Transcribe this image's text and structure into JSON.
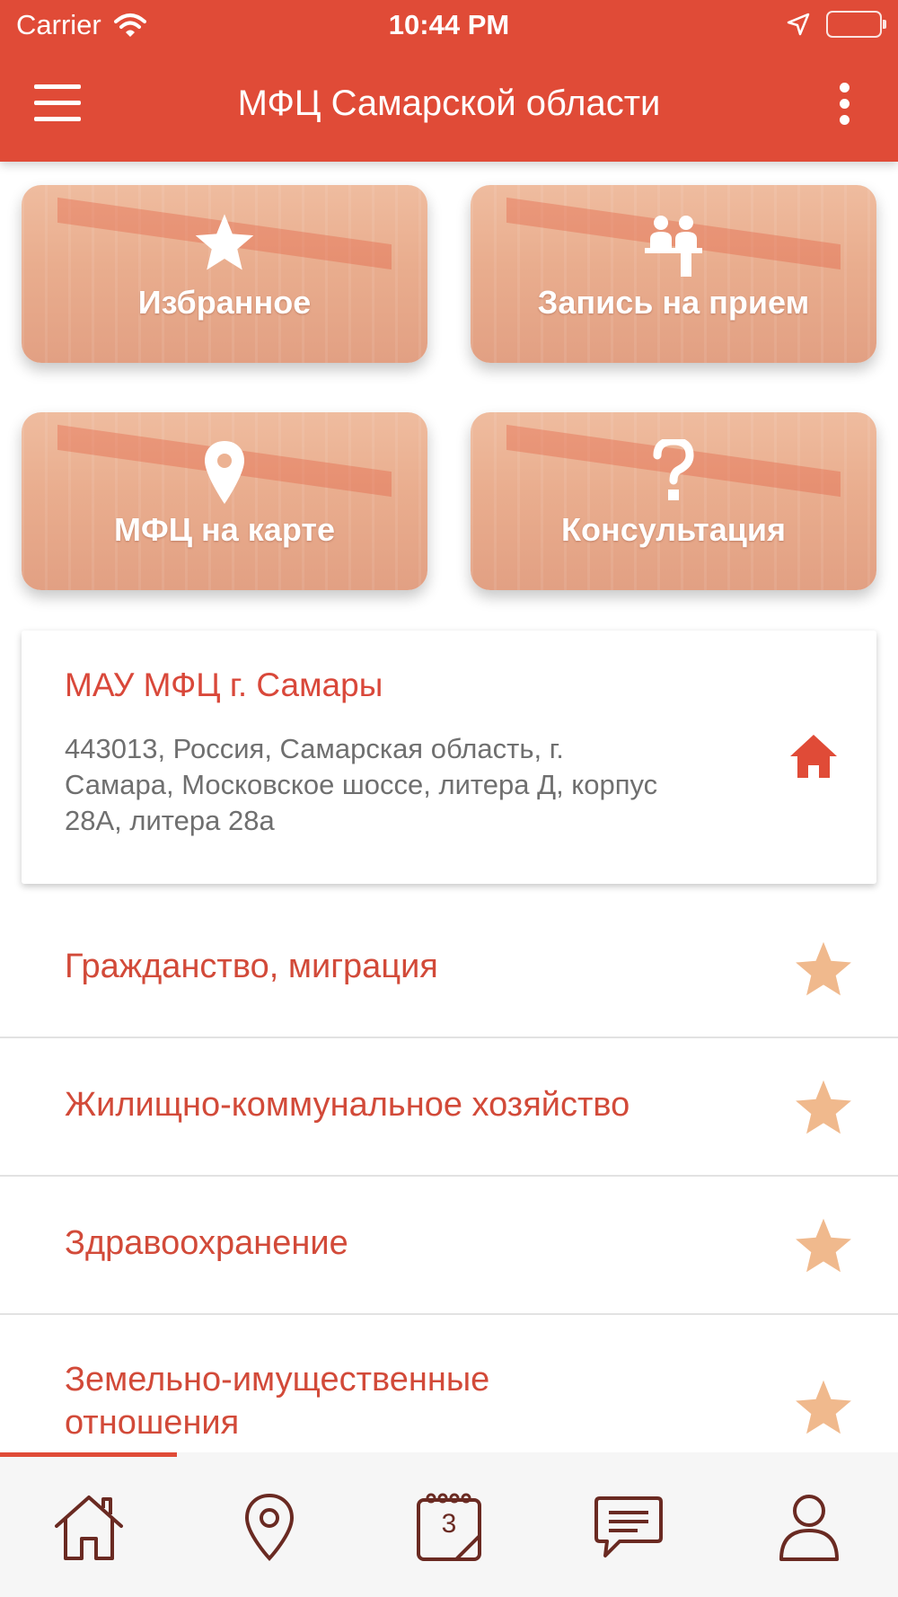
{
  "status_bar": {
    "carrier": "Carrier",
    "time": "10:44 PM"
  },
  "header": {
    "title": "МФЦ Самарской области"
  },
  "tiles": [
    {
      "label": "Избранное",
      "icon": "star-icon"
    },
    {
      "label": "Запись на прием",
      "icon": "people-queue-icon"
    },
    {
      "label": "МФЦ на карте",
      "icon": "map-pin-icon"
    },
    {
      "label": "Консультация",
      "icon": "question-icon"
    }
  ],
  "office": {
    "name": "МАУ МФЦ г. Самары",
    "address_lines": [
      "443013, Россия, Самарская область, г.",
      "Самара, Московское шоссе, литера Д, корпус",
      "28А, литера 28а"
    ]
  },
  "categories": [
    {
      "lines": [
        "Гражданство, миграция"
      ]
    },
    {
      "lines": [
        "Жилищно-коммунальное хозяйство"
      ]
    },
    {
      "lines": [
        "Здравоохранение"
      ]
    },
    {
      "lines": [
        "Земельно-имущественные",
        "отношения"
      ]
    }
  ],
  "bottom_nav": {
    "items": [
      "home-icon",
      "map-pin-icon",
      "calendar-icon",
      "chat-icon",
      "profile-icon"
    ],
    "calendar_day": "3",
    "active_index": 0
  },
  "colors": {
    "brand": "#e04b37",
    "category_text": "#d24a39",
    "star": "#f0b98d",
    "nav_icon": "#6a2a22"
  }
}
